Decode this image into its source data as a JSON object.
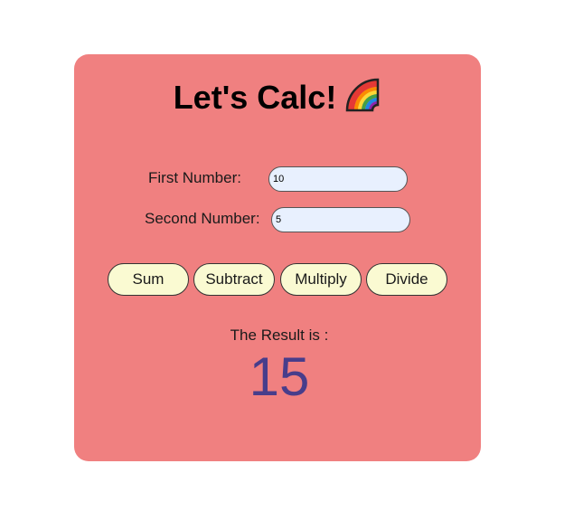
{
  "title": "Let's Calc!",
  "title_icon": "rainbow-icon",
  "form": {
    "first_label": "First Number:",
    "first_value": "10",
    "second_label": "Second Number:",
    "second_value": "5"
  },
  "buttons": {
    "sum": "Sum",
    "subtract": "Subtract",
    "multiply": "Multiply",
    "divide": "Divide"
  },
  "result": {
    "label": "The Result is :",
    "value": "15"
  },
  "colors": {
    "card_background": "#f08080",
    "input_background": "#e8f0fe",
    "button_background": "#fafad2",
    "result_color": "#483d8b"
  }
}
